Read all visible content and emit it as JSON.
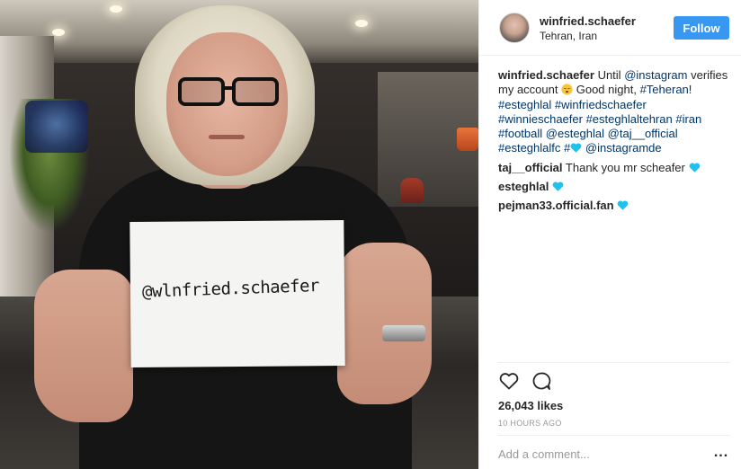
{
  "photo": {
    "sign_text": "@wlnfried.schaefer"
  },
  "header": {
    "username": "winfried.schaefer",
    "location": "Tehran, Iran",
    "follow_label": "Follow"
  },
  "caption": {
    "username": "winfried.schaefer",
    "text_part1": "Until",
    "mention1": "@instagram",
    "text_part2": "verifies my account",
    "emoji1": "sleepy-face",
    "text_part3": "Good night,",
    "hashtag_teheran": "#Teheran",
    "text_part4": "!",
    "hashtags_line": [
      "#esteghlal",
      "#winfriedschaefer",
      "#winnieschaefer",
      "#esteghlaltehran",
      "#iran",
      "#football"
    ],
    "mention2": "@esteghlal",
    "mention3": "@taj__official",
    "hashtag_last": "#esteghlalfc",
    "hashtag_hash": "#",
    "emoji2": "blue-heart",
    "mention4": "@instagramde"
  },
  "comments": [
    {
      "user": "taj__official",
      "text": "Thank you mr scheafer",
      "emoji": "blue-heart"
    },
    {
      "user": "esteghlal",
      "text": "",
      "emoji": "blue-heart"
    },
    {
      "user": "pejman33.official.fan",
      "text": "",
      "emoji": "blue-heart"
    }
  ],
  "stats": {
    "likes": "26,043 likes",
    "time_ago": "10 HOURS AGO"
  },
  "comment_box": {
    "placeholder": "Add a comment...",
    "more_label": "..."
  },
  "colors": {
    "accent": "#3897f0",
    "link": "#003569",
    "heart": "#1ec2ef",
    "muted": "#999999"
  },
  "icons": [
    "heart-outline-icon",
    "comment-bubble-icon",
    "more-options-icon"
  ]
}
